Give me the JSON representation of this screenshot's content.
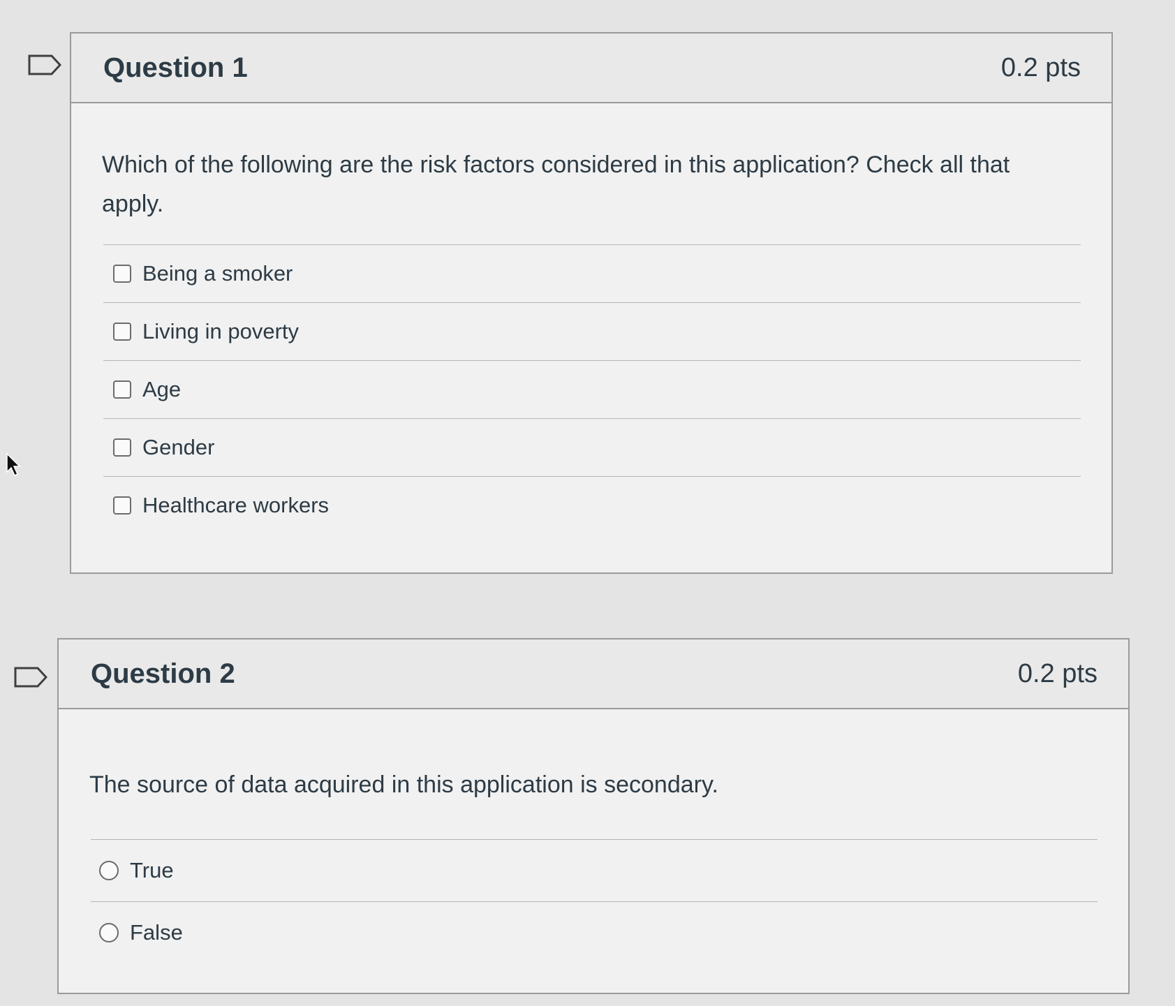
{
  "question1": {
    "title": "Question 1",
    "points": "0.2 pts",
    "prompt": "Which of the following are the risk factors considered in this application?  Check all that apply.",
    "answers": [
      "Being a smoker",
      "Living in poverty",
      "Age",
      "Gender",
      "Healthcare workers"
    ]
  },
  "question2": {
    "title": "Question 2",
    "points": "0.2 pts",
    "prompt": "The source of data acquired in this application is secondary.",
    "answers": [
      "True",
      "False"
    ]
  },
  "icons": {
    "flag": "flag-question-icon",
    "cursor": "mouse-pointer-icon"
  }
}
